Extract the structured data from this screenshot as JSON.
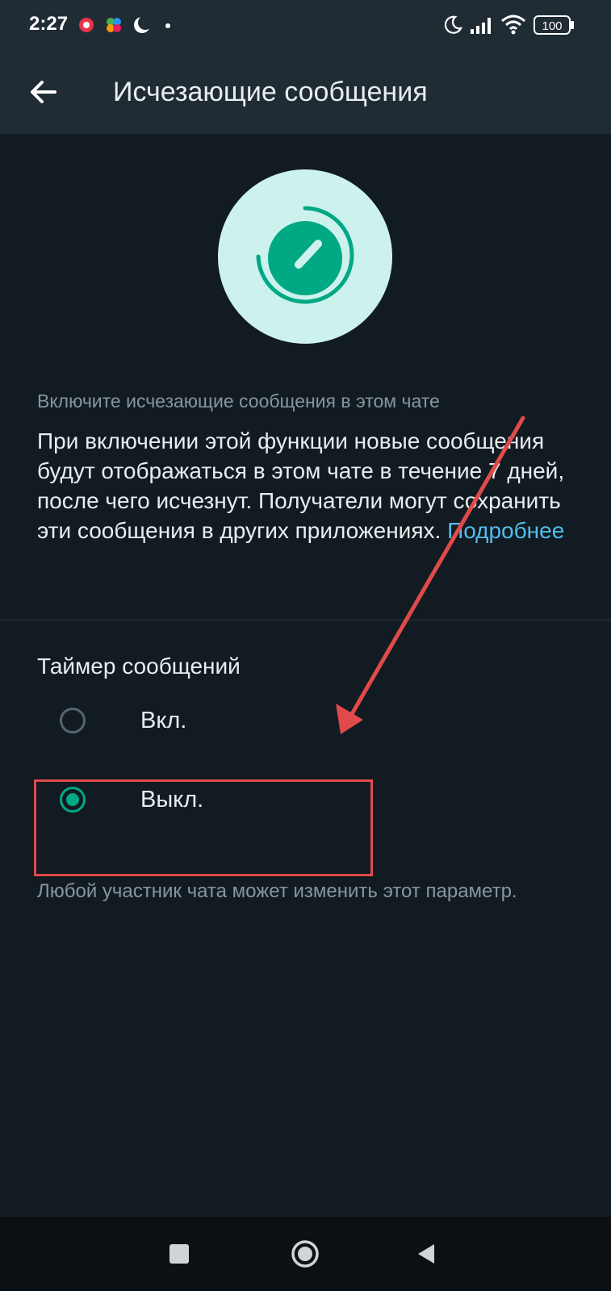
{
  "status_bar": {
    "time": "2:27",
    "battery": "100",
    "icons": [
      "notification-icon",
      "colorful-app-icon",
      "moon-app-icon",
      "dot-icon",
      "do-not-disturb-icon",
      "signal-icon",
      "wifi-icon",
      "battery-icon"
    ]
  },
  "header": {
    "title": "Исчезающие сообщения",
    "back_icon": "arrow-left-icon"
  },
  "hero": {
    "icon": "disappearing-timer-icon"
  },
  "content": {
    "caption": "Включите исчезающие сообщения в этом чате",
    "description": "При включении этой функции новые сообщения будут отображаться в этом чате в течение 7 дней, после чего исчезнут. Получатели могут сохранить эти сообщения в других приложениях.",
    "learn_more": "Подробнее"
  },
  "timer": {
    "title": "Таймер сообщений",
    "options": [
      {
        "label": "Вкл.",
        "selected": false
      },
      {
        "label": "Выкл.",
        "selected": true
      }
    ],
    "note": "Любой участник чата может изменить этот параметр."
  },
  "nav_bar": {
    "icons": [
      "recent-apps-icon",
      "home-icon",
      "back-icon"
    ]
  },
  "colors": {
    "background": "#121b22",
    "bar": "#1f2c34",
    "accent": "#00a884",
    "link": "#53bdeb",
    "annotation": "#e04a4a"
  }
}
